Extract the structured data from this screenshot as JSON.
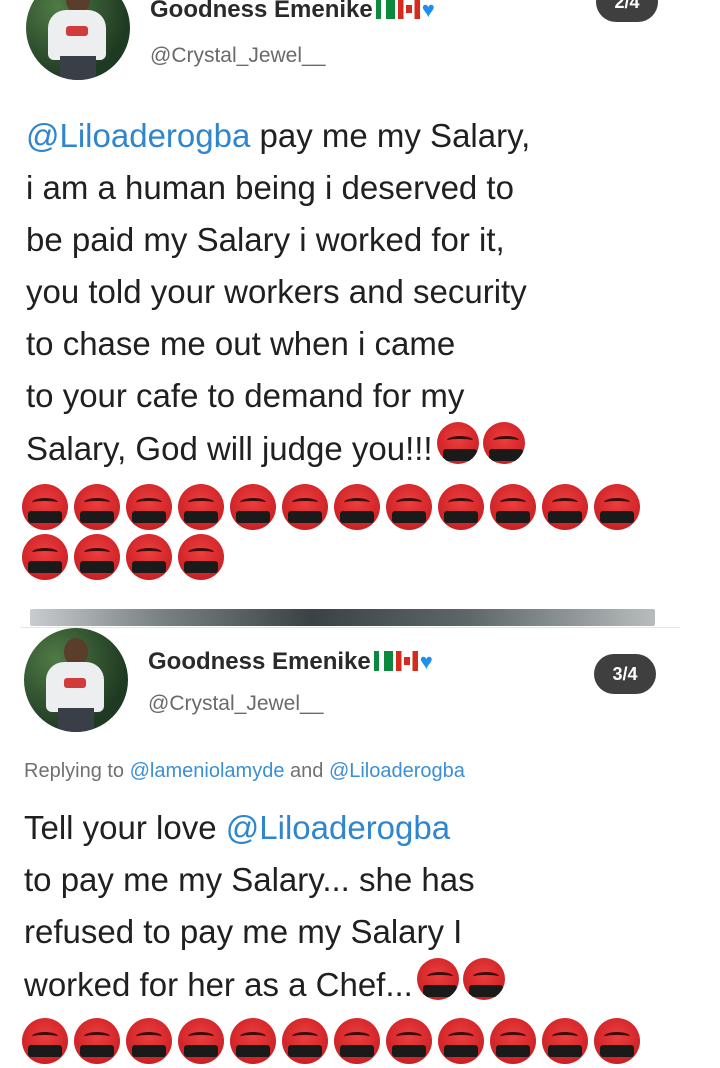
{
  "tweets": [
    {
      "name": "Goodness Emenike",
      "handle": "@Crystal_Jewel__",
      "badge": "2/4",
      "mention": "@Liloaderogba",
      "text_after_mention": " pay me my Salary,\ni am a human being i deserved to\nbe paid my Salary i worked for it,\nyou told your workers and security\nto chase me out when i came\nto your cafe to demand for my\nSalary, God will judge you!!!",
      "emoji_name": "face-with-symbols-on-mouth",
      "trailing_emoji_count": 2,
      "emoji_rows": [
        12,
        4
      ]
    },
    {
      "name": "Goodness Emenike",
      "handle": "@Crystal_Jewel__",
      "badge": "3/4",
      "reply_prefix": "Replying to ",
      "reply_user1": "@lameniolamyde",
      "reply_and": " and ",
      "reply_user2": "@Liloaderogba",
      "text_before_mention": "Tell your love ",
      "mention": "@Liloaderogba",
      "text_after_mention": "\nto pay me my Salary... she has\nrefused to pay me my Salary I\nworked for her as a Chef...",
      "emoji_name": "face-with-symbols-on-mouth",
      "trailing_emoji_count": 2,
      "emoji_rows": [
        12
      ]
    }
  ],
  "flags": [
    "nigeria-flag",
    "nigeria-flag",
    "canada-flag",
    "blue-heart"
  ],
  "colors": {
    "mention": "#2f86cf",
    "badge_bg": "#3f3f3f",
    "angry_emoji": "#d32a2e"
  }
}
